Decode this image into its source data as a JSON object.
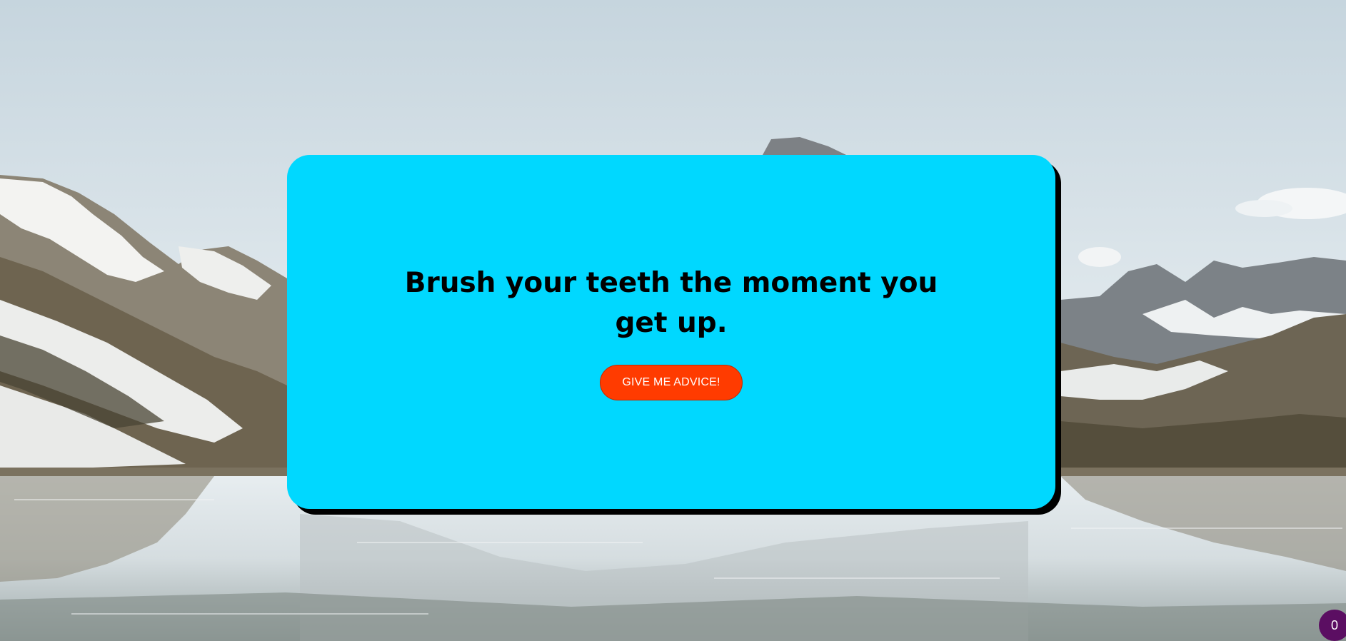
{
  "advice": {
    "text": "Brush your teeth the moment you get up."
  },
  "button": {
    "label": "GIVE ME ADVICE!"
  },
  "counter": {
    "value": "0"
  },
  "colors": {
    "card": "#00d8ff",
    "button": "#ff3b00",
    "counter": "#5b0e62"
  },
  "background": {
    "description_icon": "mountain-lake-photo"
  }
}
